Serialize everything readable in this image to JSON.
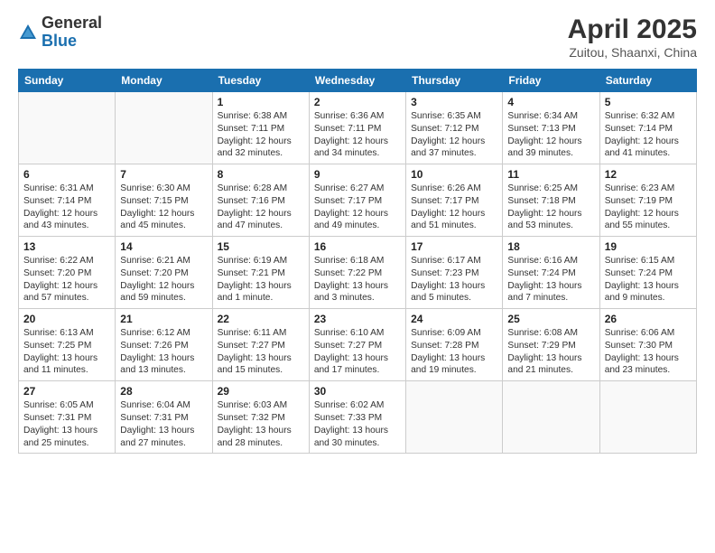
{
  "logo": {
    "general": "General",
    "blue": "Blue"
  },
  "title": {
    "month_year": "April 2025",
    "location": "Zuitou, Shaanxi, China"
  },
  "days_of_week": [
    "Sunday",
    "Monday",
    "Tuesday",
    "Wednesday",
    "Thursday",
    "Friday",
    "Saturday"
  ],
  "weeks": [
    [
      {
        "day": "",
        "info": ""
      },
      {
        "day": "",
        "info": ""
      },
      {
        "day": "1",
        "info": "Sunrise: 6:38 AM\nSunset: 7:11 PM\nDaylight: 12 hours\nand 32 minutes."
      },
      {
        "day": "2",
        "info": "Sunrise: 6:36 AM\nSunset: 7:11 PM\nDaylight: 12 hours\nand 34 minutes."
      },
      {
        "day": "3",
        "info": "Sunrise: 6:35 AM\nSunset: 7:12 PM\nDaylight: 12 hours\nand 37 minutes."
      },
      {
        "day": "4",
        "info": "Sunrise: 6:34 AM\nSunset: 7:13 PM\nDaylight: 12 hours\nand 39 minutes."
      },
      {
        "day": "5",
        "info": "Sunrise: 6:32 AM\nSunset: 7:14 PM\nDaylight: 12 hours\nand 41 minutes."
      }
    ],
    [
      {
        "day": "6",
        "info": "Sunrise: 6:31 AM\nSunset: 7:14 PM\nDaylight: 12 hours\nand 43 minutes."
      },
      {
        "day": "7",
        "info": "Sunrise: 6:30 AM\nSunset: 7:15 PM\nDaylight: 12 hours\nand 45 minutes."
      },
      {
        "day": "8",
        "info": "Sunrise: 6:28 AM\nSunset: 7:16 PM\nDaylight: 12 hours\nand 47 minutes."
      },
      {
        "day": "9",
        "info": "Sunrise: 6:27 AM\nSunset: 7:17 PM\nDaylight: 12 hours\nand 49 minutes."
      },
      {
        "day": "10",
        "info": "Sunrise: 6:26 AM\nSunset: 7:17 PM\nDaylight: 12 hours\nand 51 minutes."
      },
      {
        "day": "11",
        "info": "Sunrise: 6:25 AM\nSunset: 7:18 PM\nDaylight: 12 hours\nand 53 minutes."
      },
      {
        "day": "12",
        "info": "Sunrise: 6:23 AM\nSunset: 7:19 PM\nDaylight: 12 hours\nand 55 minutes."
      }
    ],
    [
      {
        "day": "13",
        "info": "Sunrise: 6:22 AM\nSunset: 7:20 PM\nDaylight: 12 hours\nand 57 minutes."
      },
      {
        "day": "14",
        "info": "Sunrise: 6:21 AM\nSunset: 7:20 PM\nDaylight: 12 hours\nand 59 minutes."
      },
      {
        "day": "15",
        "info": "Sunrise: 6:19 AM\nSunset: 7:21 PM\nDaylight: 13 hours\nand 1 minute."
      },
      {
        "day": "16",
        "info": "Sunrise: 6:18 AM\nSunset: 7:22 PM\nDaylight: 13 hours\nand 3 minutes."
      },
      {
        "day": "17",
        "info": "Sunrise: 6:17 AM\nSunset: 7:23 PM\nDaylight: 13 hours\nand 5 minutes."
      },
      {
        "day": "18",
        "info": "Sunrise: 6:16 AM\nSunset: 7:24 PM\nDaylight: 13 hours\nand 7 minutes."
      },
      {
        "day": "19",
        "info": "Sunrise: 6:15 AM\nSunset: 7:24 PM\nDaylight: 13 hours\nand 9 minutes."
      }
    ],
    [
      {
        "day": "20",
        "info": "Sunrise: 6:13 AM\nSunset: 7:25 PM\nDaylight: 13 hours\nand 11 minutes."
      },
      {
        "day": "21",
        "info": "Sunrise: 6:12 AM\nSunset: 7:26 PM\nDaylight: 13 hours\nand 13 minutes."
      },
      {
        "day": "22",
        "info": "Sunrise: 6:11 AM\nSunset: 7:27 PM\nDaylight: 13 hours\nand 15 minutes."
      },
      {
        "day": "23",
        "info": "Sunrise: 6:10 AM\nSunset: 7:27 PM\nDaylight: 13 hours\nand 17 minutes."
      },
      {
        "day": "24",
        "info": "Sunrise: 6:09 AM\nSunset: 7:28 PM\nDaylight: 13 hours\nand 19 minutes."
      },
      {
        "day": "25",
        "info": "Sunrise: 6:08 AM\nSunset: 7:29 PM\nDaylight: 13 hours\nand 21 minutes."
      },
      {
        "day": "26",
        "info": "Sunrise: 6:06 AM\nSunset: 7:30 PM\nDaylight: 13 hours\nand 23 minutes."
      }
    ],
    [
      {
        "day": "27",
        "info": "Sunrise: 6:05 AM\nSunset: 7:31 PM\nDaylight: 13 hours\nand 25 minutes."
      },
      {
        "day": "28",
        "info": "Sunrise: 6:04 AM\nSunset: 7:31 PM\nDaylight: 13 hours\nand 27 minutes."
      },
      {
        "day": "29",
        "info": "Sunrise: 6:03 AM\nSunset: 7:32 PM\nDaylight: 13 hours\nand 28 minutes."
      },
      {
        "day": "30",
        "info": "Sunrise: 6:02 AM\nSunset: 7:33 PM\nDaylight: 13 hours\nand 30 minutes."
      },
      {
        "day": "",
        "info": ""
      },
      {
        "day": "",
        "info": ""
      },
      {
        "day": "",
        "info": ""
      }
    ]
  ]
}
